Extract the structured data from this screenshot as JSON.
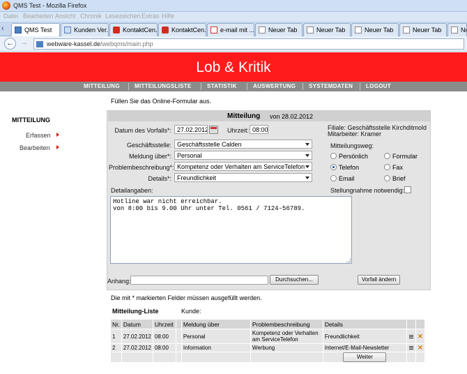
{
  "window": {
    "title": "QMS Test - Mozilla Firefox"
  },
  "menubar": [
    "Datei",
    "Bearbeiten",
    "Ansicht",
    "Chronik",
    "Lesezeichen",
    "Extras",
    "Hilfe"
  ],
  "tabs": [
    {
      "label": "QMS Test",
      "icon": "qms-page-icon",
      "active": true
    },
    {
      "label": "Kunden Ver...",
      "icon": "page-icon"
    },
    {
      "label": "KontaktCen...",
      "icon": "kontakt-icon"
    },
    {
      "label": "KontaktCen...",
      "icon": "kontakt-icon"
    },
    {
      "label": "e-mail mit ...",
      "icon": "gmail-icon"
    },
    {
      "label": "Neuer Tab",
      "icon": "blank-page-icon"
    },
    {
      "label": "Neuer Tab",
      "icon": "blank-page-icon"
    },
    {
      "label": "Neuer Tab",
      "icon": "blank-page-icon"
    },
    {
      "label": "Neuer Tab",
      "icon": "blank-page-icon"
    },
    {
      "label": "Neue",
      "icon": "blank-page-icon"
    }
  ],
  "url": {
    "domain": "webware-kassel.de",
    "path": "/webqms/main.php"
  },
  "banner": {
    "title": "Lob & Kritik",
    "color": "#ff1b1b"
  },
  "topmenu": [
    "MITTEILUNG",
    "MITTEILUNGSLISTE",
    "STATISTIK",
    "AUSWERTUNG",
    "SYSTEMDATEN",
    "LOGOUT"
  ],
  "sidebar": {
    "heading": "MITTEILUNG",
    "items": [
      "Erfassen",
      "Bearbeiten"
    ]
  },
  "form": {
    "intro": "Füllen Sie das Online-Formular aus.",
    "title": "Mitteilung",
    "date_text": "von 28.02.2012",
    "datum_label": "Datum des Vorfalls*:",
    "datum_value": "27.02.2012",
    "uhrzeit_label": "Uhrzeit:",
    "uhrzeit_value": "08:00",
    "filiale": "Filiale: Geschäftsstelle Kirchditmold",
    "mitarbeiter": "Mitarbeiter: Kramer",
    "geschaeftsstelle_label": "Geschäftsstelle:",
    "geschaeftsstelle_value": "Geschäftsstelle Calden",
    "meldung_label": "Meldung über*:",
    "meldung_value": "Personal",
    "problem_label": "Problembeschreibung*:",
    "problem_value": "Kompetenz oder Verhalten am ServiceTelefon",
    "details_label": "Details*:",
    "details_value": "Freundlichkeit",
    "weg_label": "Mitteilungsweg:",
    "weg_options": [
      "Persönlich",
      "Formular",
      "Telefon",
      "Fax",
      "Email",
      "Brief"
    ],
    "weg_selected": "Telefon",
    "stellungnahme_label": "Stellungnahme notwendig:",
    "detail_label": "Detailangaben:",
    "detail_text": "Hotline war nicht erreichbar.\nvon 8:00 bis 9.00 Uhr unter Tel. 0561 / 7124-56789.",
    "anhang_label": "Anhang:",
    "browse_label": "Durchsuchen...",
    "submit_label": "Vorfall ändern",
    "mandatory_note": "Die mit * markierten Felder müssen ausgefüllt werden."
  },
  "list": {
    "title": "Mitteilung-Liste",
    "kunde_label": "Kunde:",
    "headers": [
      "Nr.",
      "Datum",
      "Uhrzeit",
      "Meldung über",
      "Problembeschreibung",
      "Details"
    ],
    "rows": [
      {
        "nr": "1",
        "datum": "27.02.2012",
        "uhrzeit": "08:00",
        "meldung": "Personal",
        "problem_1": "Kompetenz oder Verhalten",
        "problem_2": "am ServiceTelefon",
        "details": "Freundlichkeit"
      },
      {
        "nr": "2",
        "datum": "27.02.2012",
        "uhrzeit": "08:00",
        "meldung": "Information",
        "problem_1": "Werbung",
        "problem_2": "",
        "details": "Internet/E-Mail-Newsletter"
      }
    ],
    "next_label": "Weiter"
  }
}
